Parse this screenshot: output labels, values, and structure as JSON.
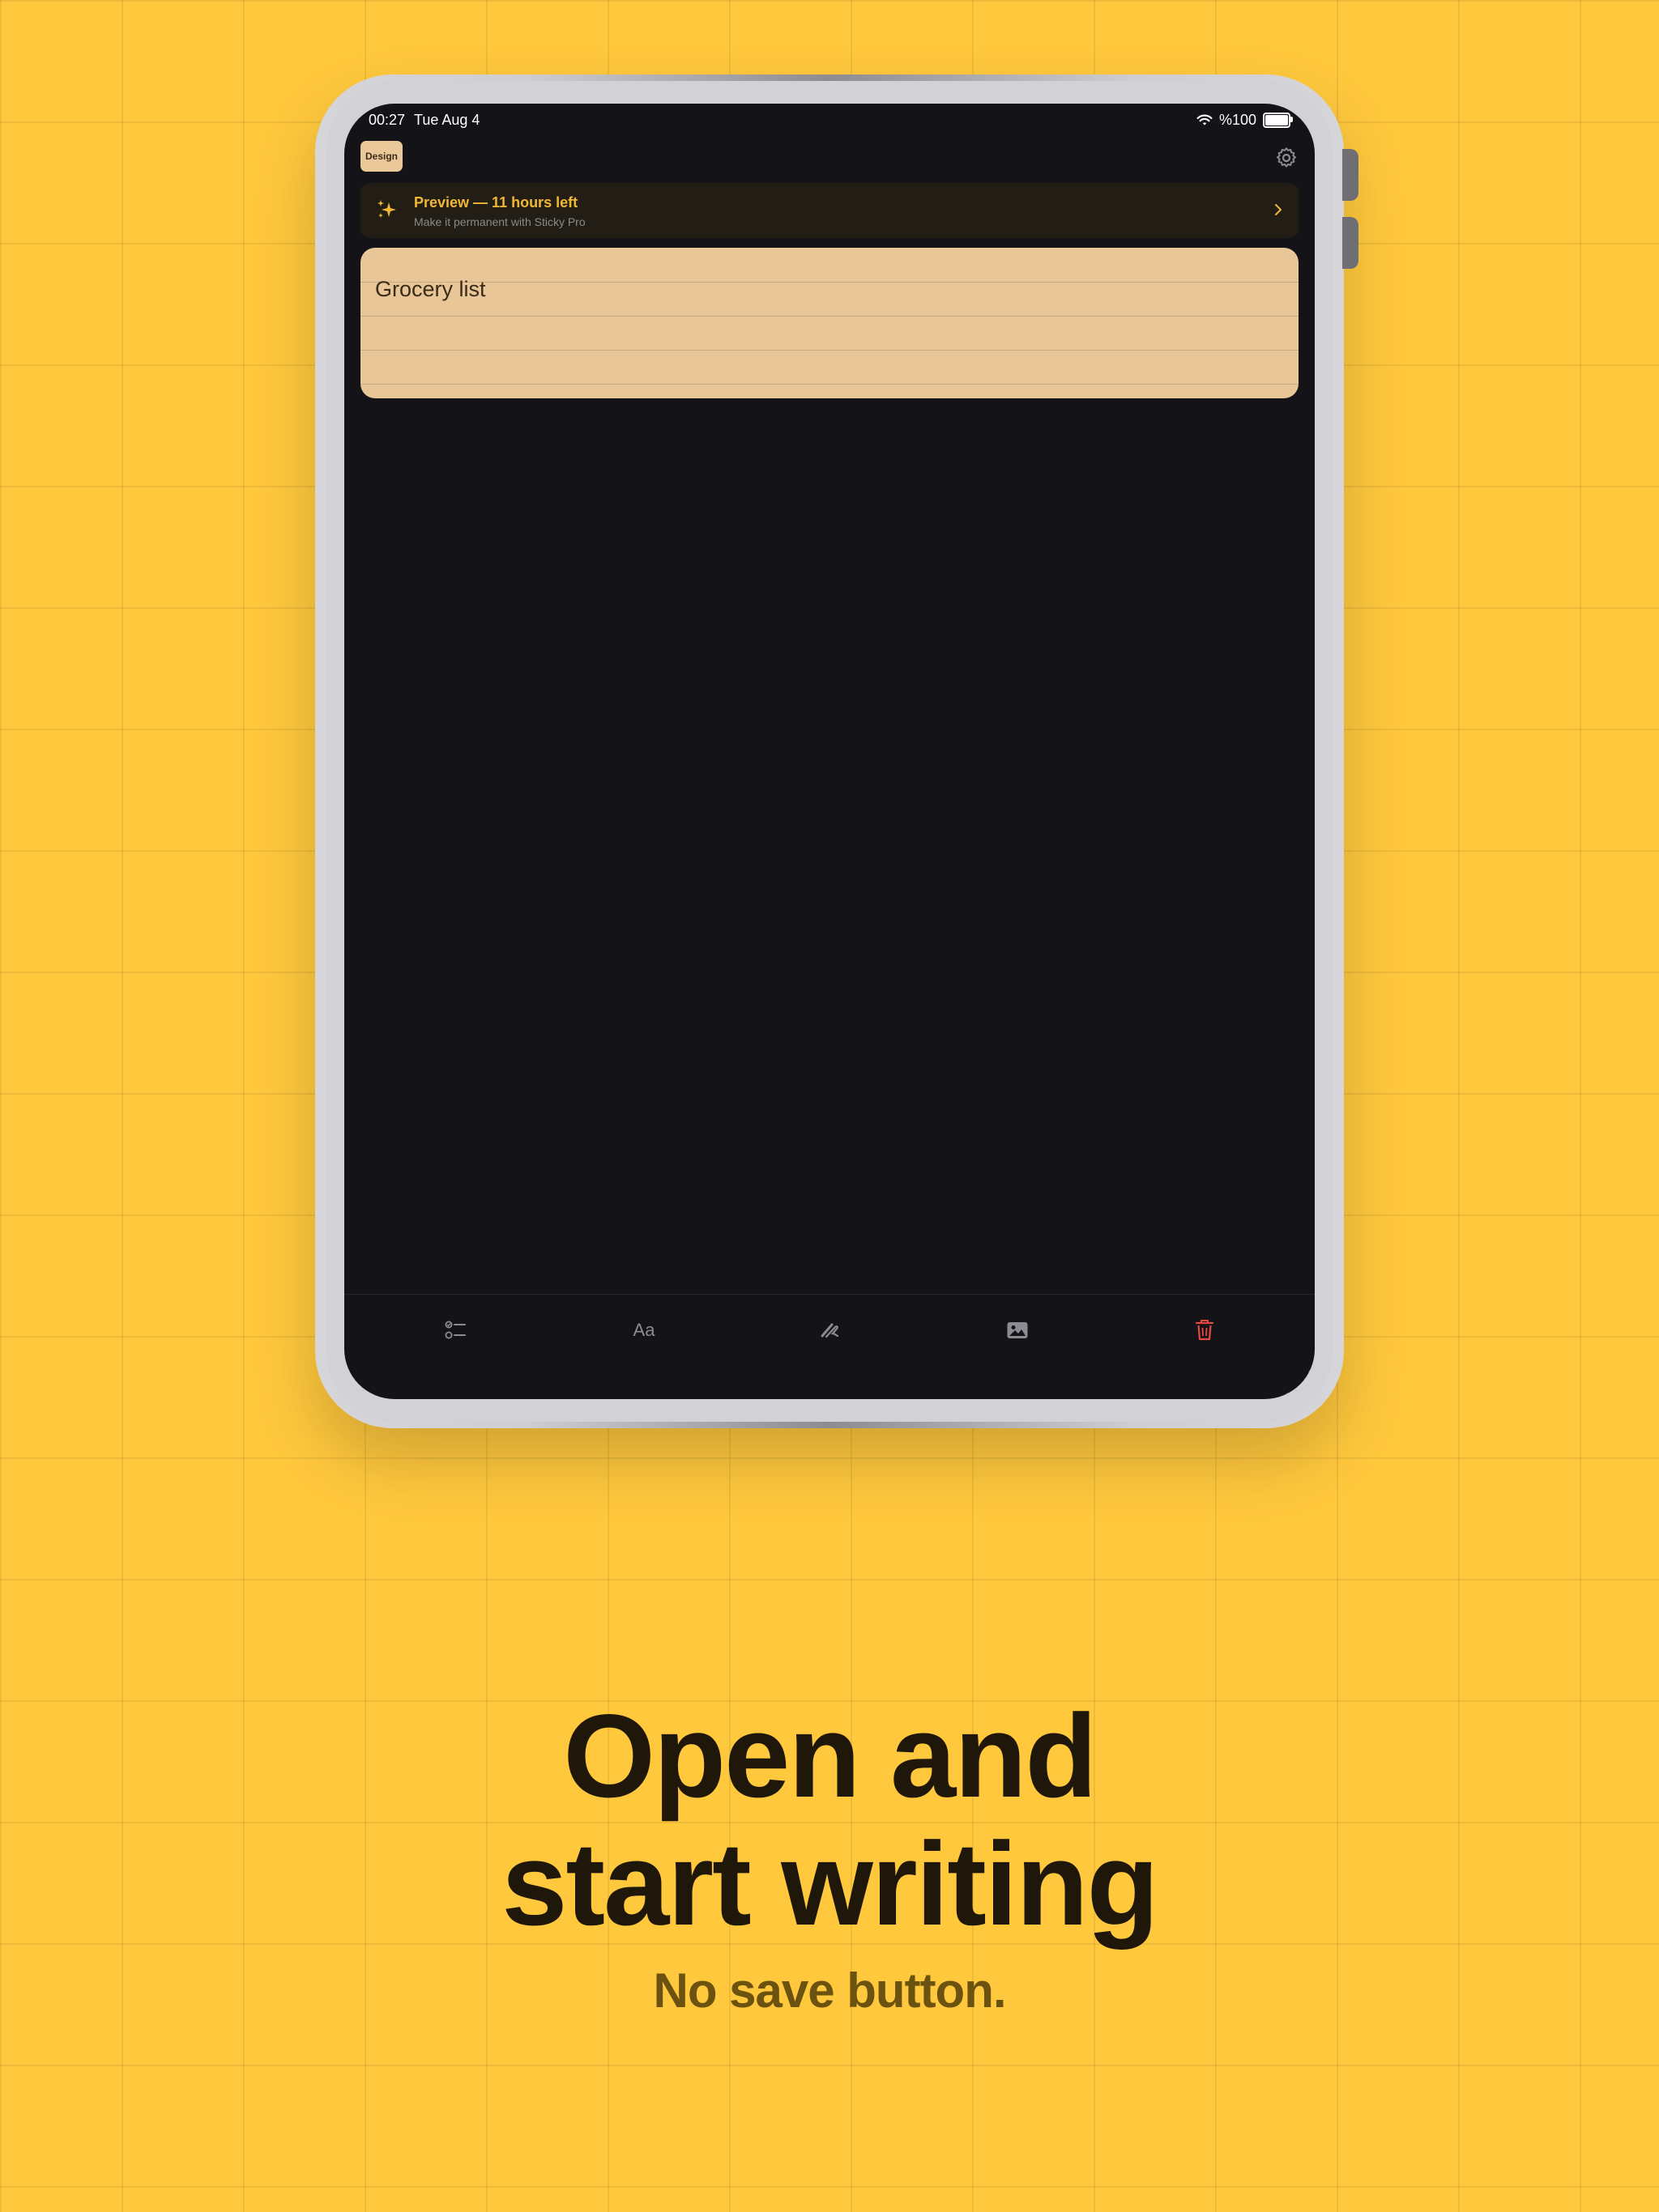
{
  "status_bar": {
    "time": "00:27",
    "date": "Tue Aug 4",
    "battery": "%100",
    "wifi_icon": "wifi-icon",
    "battery_icon": "battery-icon"
  },
  "top_bar": {
    "tag_label": "Design",
    "settings_icon": "gear-icon"
  },
  "banner": {
    "title": "Preview — 11 hours left",
    "subtitle": "Make it permanent with Sticky Pro",
    "icon": "sparkles-icon",
    "accent_color": "#f2b834"
  },
  "note": {
    "title": "Grocery list",
    "color": "#e8c697"
  },
  "toolbar": {
    "items": [
      {
        "name": "checklist-icon"
      },
      {
        "label": "Aa",
        "name": "text-format-icon"
      },
      {
        "name": "draw-icon"
      },
      {
        "name": "image-icon"
      },
      {
        "name": "trash-icon",
        "color": "#e5483f"
      }
    ]
  },
  "marketing": {
    "headline_line1": "Open and",
    "headline_line2": "start writing",
    "subheadline": "No save button.",
    "background_color": "#ffc83d"
  }
}
